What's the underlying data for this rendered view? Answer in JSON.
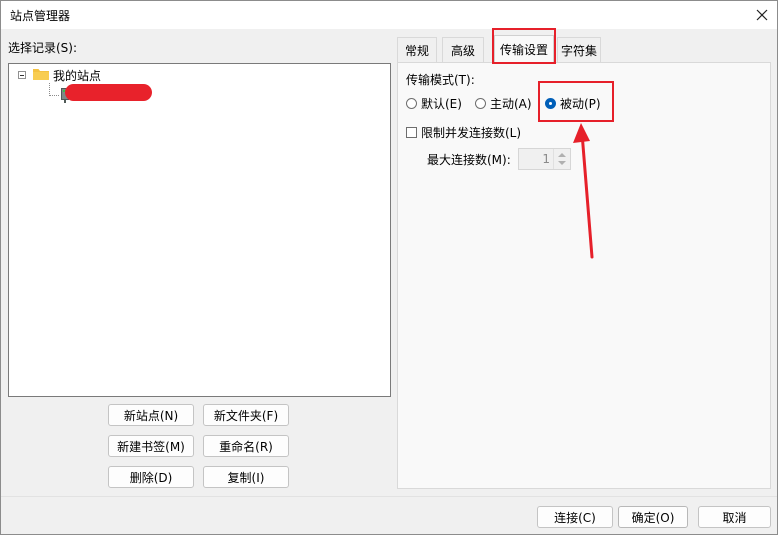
{
  "window": {
    "title": "站点管理器"
  },
  "left": {
    "select_label": "选择记录(S):",
    "tree": {
      "root_label": "我的站点"
    }
  },
  "left_buttons": {
    "new_site": "新站点(N)",
    "new_folder": "新文件夹(F)",
    "new_bookmark": "新建书签(M)",
    "rename": "重命名(R)",
    "delete": "删除(D)",
    "copy": "复制(I)"
  },
  "tabs": [
    {
      "label": "常规"
    },
    {
      "label": "高级"
    },
    {
      "label": "传输设置",
      "active": true
    },
    {
      "label": "字符集"
    }
  ],
  "transfer": {
    "mode_label": "传输模式(T):",
    "modes": [
      {
        "label": "默认(E)",
        "selected": false
      },
      {
        "label": "主动(A)",
        "selected": false
      },
      {
        "label": "被动(P)",
        "selected": true
      }
    ],
    "limit_connections_label": "限制并发连接数(L)",
    "limit_connections_checked": false,
    "max_connections_label": "最大连接数(M):",
    "max_connections_value": "1"
  },
  "footer_buttons": {
    "connect": "连接(C)",
    "ok": "确定(O)",
    "cancel": "取消"
  },
  "colors": {
    "annotation_red": "#e6202a",
    "radio_selected": "#005fb8",
    "redaction": "#e8222b"
  },
  "icons": [
    "close-icon",
    "folder-icon",
    "server-icon",
    "tree-collapse-icon",
    "annotation-arrow-icon"
  ]
}
